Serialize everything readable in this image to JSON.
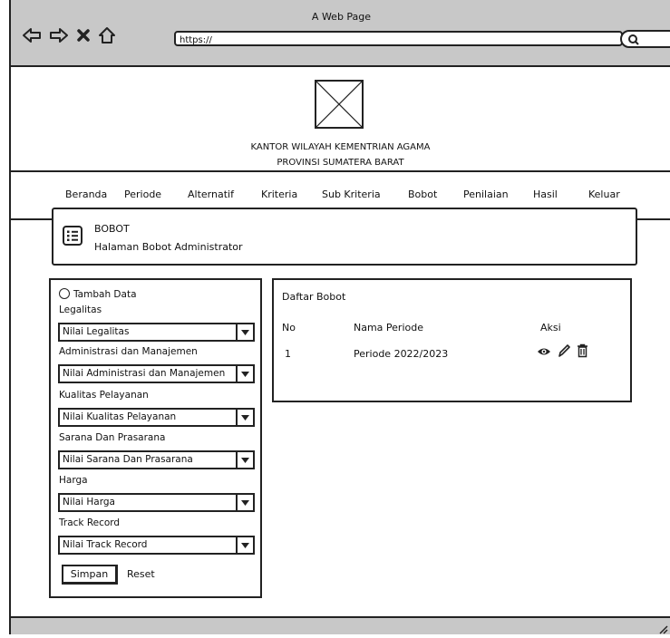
{
  "window": {
    "title": "A Web Page"
  },
  "browser": {
    "url": "https://"
  },
  "header": {
    "office_line1": "KANTOR WILAYAH KEMENTRIAN AGAMA",
    "office_line2": "PROVINSI SUMATERA BARAT"
  },
  "menu": [
    "Beranda",
    "Periode",
    "Alternatif",
    "Kriteria",
    "Sub Kriteria",
    "Bobot",
    "Penilaian",
    "Hasil",
    "Keluar"
  ],
  "page": {
    "title": "BOBOT",
    "subtitle": "Halaman Bobot Administrator"
  },
  "form": {
    "add_label": "Tambah Data",
    "fields": [
      {
        "label": "Legalitas",
        "value": "Nilai Legalitas"
      },
      {
        "label": "Administrasi dan Manajemen",
        "value": "Nilai Administrasi dan Manajemen"
      },
      {
        "label": "Kualitas Pelayanan",
        "value": "Nilai Kualitas Pelayanan"
      },
      {
        "label": "Sarana Dan Prasarana",
        "value": "Nilai Sarana Dan Prasarana"
      },
      {
        "label": "Harga",
        "value": "Nilai Harga"
      },
      {
        "label": "Track Record",
        "value": "Nilai Track Record"
      }
    ],
    "save_label": "Simpan",
    "reset_label": "Reset"
  },
  "table": {
    "title": "Daftar Bobot",
    "headers": [
      "No",
      "Nama Periode",
      "Aksi"
    ],
    "rows": [
      {
        "no": "1",
        "periode": "Periode 2022/2023"
      }
    ],
    "actions": [
      "view-icon",
      "edit-icon",
      "delete-icon"
    ]
  }
}
